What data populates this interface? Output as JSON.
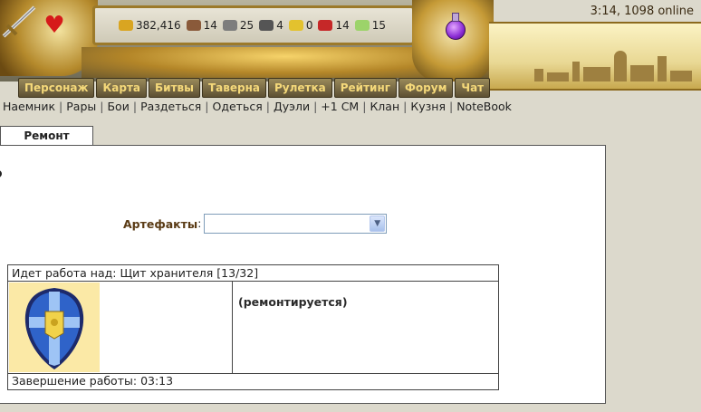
{
  "status_bar": {
    "time": "3:14",
    "online": "1098 online"
  },
  "resources": [
    {
      "icon": "gold-icon",
      "value": "382,416",
      "color": "#d9a521"
    },
    {
      "icon": "ore-icon",
      "value": "14",
      "color": "#8a5a3a"
    },
    {
      "icon": "gears-icon",
      "value": "25",
      "color": "#7d7d7d"
    },
    {
      "icon": "skull-icon",
      "value": "4",
      "color": "#555555"
    },
    {
      "icon": "bell-icon",
      "value": "0",
      "color": "#e3c22e"
    },
    {
      "icon": "ruby-icon",
      "value": "14",
      "color": "#c62828"
    },
    {
      "icon": "crystal-icon",
      "value": "15",
      "color": "#9cd36a"
    }
  ],
  "nav": {
    "tabs": [
      "Персонаж",
      "Карта",
      "Битвы",
      "Таверна",
      "Рулетка",
      "Рейтинг",
      "Форум",
      "Чат"
    ]
  },
  "links": [
    "Наемник",
    "Рары",
    "Бои",
    "Раздеться",
    "Одеться",
    "Дуэли",
    "+1 СМ",
    "Клан",
    "Кузня",
    "NoteBook"
  ],
  "repair_tab": {
    "label": "Ремонт"
  },
  "artifact": {
    "label": "Артефакты",
    "colon": ":",
    "selected": ""
  },
  "work": {
    "title_prefix": "Идет работа над:",
    "item_name": "Щит хранителя",
    "durability": "[13/32]",
    "status": "(ремонтируется)",
    "completion_label": "Завершение работы:",
    "completion_time": "03:13"
  },
  "colors": {
    "accent_gold": "#f5d97a",
    "label_brown": "#5a3b15",
    "shield_blue": "#2f63c9",
    "shield_gold": "#f1d24a"
  }
}
